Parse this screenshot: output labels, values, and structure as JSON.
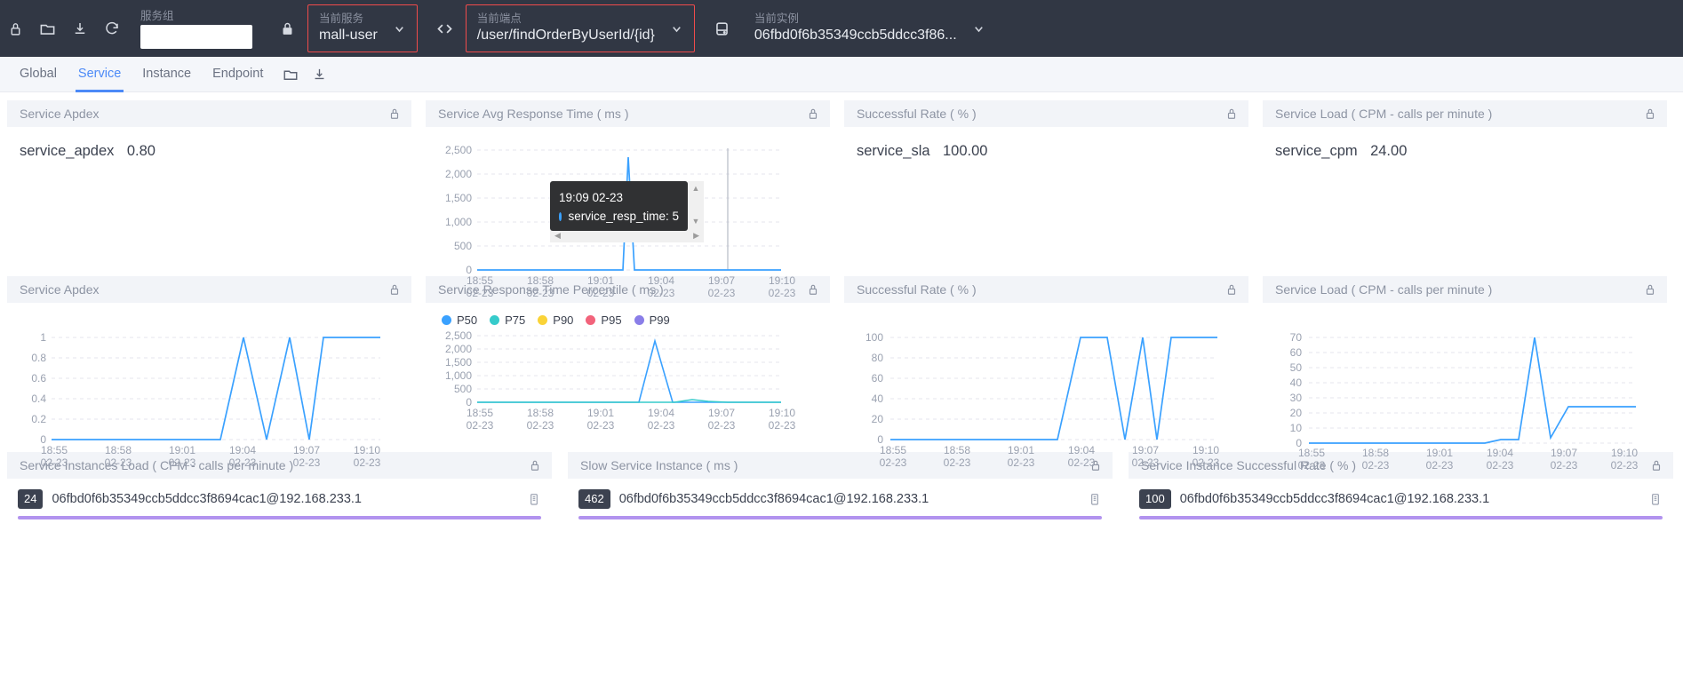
{
  "topbar": {
    "icons": [
      {
        "name": "lock-icon",
        "glyph": "lock"
      },
      {
        "name": "folder-icon",
        "glyph": "folder"
      },
      {
        "name": "download-icon",
        "glyph": "download"
      },
      {
        "name": "refresh-icon",
        "glyph": "refresh"
      }
    ],
    "service_group": {
      "label": "服务组",
      "value": "",
      "placeholder": ""
    },
    "current_service": {
      "label": "当前服务",
      "value": "mall-user",
      "highlight": "#f04b4b"
    },
    "current_endpoint": {
      "label": "当前端点",
      "value": "/user/findOrderByUserId/{id}",
      "highlight": "#f04b4b"
    },
    "current_instance": {
      "label": "当前实例",
      "value": "06fbd0f6b35349ccb5ddcc3f86..."
    }
  },
  "nav": {
    "tabs": [
      {
        "label": "Global",
        "active": false
      },
      {
        "label": "Service",
        "active": true
      },
      {
        "label": "Instance",
        "active": false
      },
      {
        "label": "Endpoint",
        "active": false
      }
    ],
    "icons": [
      {
        "name": "folder-icon"
      },
      {
        "name": "download-icon"
      }
    ]
  },
  "row1": [
    {
      "title": "Service Apdex",
      "type": "metric",
      "metric_label": "service_apdex",
      "metric_value": "0.80"
    },
    {
      "title": "Service Avg Response Time ( ms )",
      "type": "chart",
      "tooltip": {
        "time": "19:09 02-23",
        "series_label": "service_resp_time: 5"
      }
    },
    {
      "title": "Successful Rate ( % )",
      "type": "metric",
      "metric_label": "service_sla",
      "metric_value": "100.00"
    },
    {
      "title": "Service Load ( CPM - calls per minute )",
      "type": "metric",
      "metric_label": "service_cpm",
      "metric_value": "24.00"
    }
  ],
  "row2": [
    {
      "title": "Service Apdex"
    },
    {
      "title": "Service Response Time Percentile ( ms )"
    },
    {
      "title": "Successful Rate ( % )"
    },
    {
      "title": "Service Load ( CPM - calls per minute )"
    }
  ],
  "row3": [
    {
      "title": "Service Instances Load ( CPM - calls per minute )",
      "badge": "24",
      "instance": "06fbd0f6b35349ccb5ddcc3f8694cac1@192.168.233.1"
    },
    {
      "title": "Slow Service Instance ( ms )",
      "badge": "462",
      "instance": "06fbd0f6b35349ccb5ddcc3f8694cac1@192.168.233.1"
    },
    {
      "title": "Service Instance Successful Rate ( % )",
      "badge": "100",
      "instance": "06fbd0f6b35349ccb5ddcc3f8694cac1@192.168.233.1"
    }
  ],
  "legend": {
    "items": [
      {
        "label": "P50",
        "color": "#3aa1ff"
      },
      {
        "label": "P75",
        "color": "#36cbcb"
      },
      {
        "label": "P90",
        "color": "#fad337"
      },
      {
        "label": "P95",
        "color": "#f2637b"
      },
      {
        "label": "P99",
        "color": "#8a7ee8"
      }
    ]
  },
  "chart_data": [
    {
      "id": "avg_resp_time",
      "type": "line",
      "title": "Service Avg Response Time ( ms )",
      "xlabel": "",
      "ylabel": "",
      "ylim": [
        0,
        2500
      ],
      "yticks": [
        0,
        500,
        1000,
        1500,
        2000,
        2500
      ],
      "ytick_labels": [
        "0",
        "500",
        "1,000",
        "1,500",
        "2,000",
        "2,500"
      ],
      "xticks": [
        "18:55\n02-23",
        "18:58\n02-23",
        "19:01\n02-23",
        "19:04\n02-23",
        "19:07\n02-23",
        "19:10\n02-23"
      ],
      "xtick_labels": [
        [
          "18:55",
          "02-23"
        ],
        [
          "18:58",
          "02-23"
        ],
        [
          "19:01",
          "02-23"
        ],
        [
          "19:04",
          "02-23"
        ],
        [
          "19:07",
          "02-23"
        ],
        [
          "19:10",
          "02-23"
        ]
      ],
      "grid": true,
      "series": [
        {
          "name": "service_resp_time",
          "color": "#3aa1ff",
          "values": [
            0,
            0,
            0,
            0,
            0,
            0,
            0,
            0,
            0,
            0,
            0,
            0,
            0,
            0,
            0,
            0,
            0,
            2250,
            0,
            0,
            0,
            0,
            0,
            0,
            5,
            0,
            0,
            0,
            0,
            0,
            0
          ]
        }
      ]
    },
    {
      "id": "service_apdex_line",
      "type": "line",
      "title": "Service Apdex",
      "ylim": [
        0,
        1
      ],
      "yticks": [
        0,
        0.2,
        0.4,
        0.6,
        0.8,
        1
      ],
      "ytick_labels": [
        "0",
        "0.2",
        "0.4",
        "0.6",
        "0.8",
        "1"
      ],
      "xtick_labels": [
        [
          "18:55",
          "02-23"
        ],
        [
          "18:58",
          "02-23"
        ],
        [
          "19:01",
          "02-23"
        ],
        [
          "19:04",
          "02-23"
        ],
        [
          "19:07",
          "02-23"
        ],
        [
          "19:10",
          "02-23"
        ]
      ],
      "grid": true,
      "series": [
        {
          "name": "service_apdex",
          "color": "#3aa1ff",
          "values": [
            0,
            0,
            0,
            0,
            0,
            0,
            0,
            0,
            0,
            0,
            0,
            0,
            0,
            0,
            0,
            0,
            0,
            0,
            0,
            0,
            1,
            0,
            1,
            0,
            0,
            1,
            1
          ]
        }
      ]
    },
    {
      "id": "resp_time_percentile",
      "type": "line",
      "title": "Service Response Time Percentile ( ms )",
      "ylim": [
        0,
        2500
      ],
      "yticks": [
        0,
        500,
        1000,
        1500,
        2000,
        2500
      ],
      "ytick_labels": [
        "0",
        "500",
        "1,000",
        "1,500",
        "2,000",
        "2,500"
      ],
      "xtick_labels": [
        [
          "18:55",
          "02-23"
        ],
        [
          "18:58",
          "02-23"
        ],
        [
          "19:01",
          "02-23"
        ],
        [
          "19:04",
          "02-23"
        ],
        [
          "19:07",
          "02-23"
        ],
        [
          "19:10",
          "02-23"
        ]
      ],
      "grid": true,
      "legend_position": "top-left",
      "series": [
        {
          "name": "P50",
          "color": "#3aa1ff",
          "values": [
            0,
            0,
            0,
            0,
            0,
            0,
            0,
            0,
            0,
            0,
            0,
            0,
            0,
            0,
            0,
            0,
            0,
            2150,
            0,
            0,
            0,
            0,
            0,
            0,
            0,
            0,
            0
          ]
        },
        {
          "name": "P75",
          "color": "#36cbcb",
          "values": [
            0,
            0,
            0,
            0,
            0,
            0,
            0,
            0,
            0,
            0,
            0,
            0,
            0,
            0,
            0,
            0,
            0,
            0,
            0,
            0,
            60,
            0,
            0,
            0,
            0,
            0,
            0
          ]
        },
        {
          "name": "P90",
          "color": "#fad337",
          "values": [
            0,
            0,
            0,
            0,
            0,
            0,
            0,
            0,
            0,
            0,
            0,
            0,
            0,
            0,
            0,
            0,
            0,
            0,
            0,
            0,
            0,
            0,
            0,
            0,
            0,
            0,
            0
          ]
        },
        {
          "name": "P95",
          "color": "#f2637b",
          "values": [
            0,
            0,
            0,
            0,
            0,
            0,
            0,
            0,
            0,
            0,
            0,
            0,
            0,
            0,
            0,
            0,
            0,
            0,
            0,
            0,
            0,
            0,
            0,
            0,
            0,
            0,
            0
          ]
        },
        {
          "name": "P99",
          "color": "#8a7ee8",
          "values": [
            0,
            0,
            0,
            0,
            0,
            0,
            0,
            0,
            0,
            0,
            0,
            0,
            0,
            0,
            0,
            0,
            0,
            0,
            0,
            0,
            0,
            0,
            0,
            0,
            0,
            0,
            0
          ]
        }
      ]
    },
    {
      "id": "successful_rate",
      "type": "line",
      "title": "Successful Rate ( % )",
      "ylim": [
        0,
        100
      ],
      "yticks": [
        0,
        20,
        40,
        60,
        80,
        100
      ],
      "ytick_labels": [
        "0",
        "20",
        "40",
        "60",
        "80",
        "100"
      ],
      "xtick_labels": [
        [
          "18:55",
          "02-23"
        ],
        [
          "18:58",
          "02-23"
        ],
        [
          "19:01",
          "02-23"
        ],
        [
          "19:04",
          "02-23"
        ],
        [
          "19:07",
          "02-23"
        ],
        [
          "19:10",
          "02-23"
        ]
      ],
      "grid": true,
      "series": [
        {
          "name": "service_sla",
          "color": "#3aa1ff",
          "values": [
            0,
            0,
            0,
            0,
            0,
            0,
            0,
            0,
            0,
            0,
            0,
            0,
            0,
            0,
            0,
            0,
            0,
            0,
            0,
            0,
            100,
            100,
            0,
            100,
            0,
            100,
            100
          ]
        }
      ]
    },
    {
      "id": "service_load_cpm",
      "type": "line",
      "title": "Service Load ( CPM - calls per minute )",
      "ylim": [
        0,
        70
      ],
      "yticks": [
        0,
        10,
        20,
        30,
        40,
        50,
        60,
        70
      ],
      "ytick_labels": [
        "0",
        "10",
        "20",
        "30",
        "40",
        "50",
        "60",
        "70"
      ],
      "xtick_labels": [
        [
          "18:55",
          "02-23"
        ],
        [
          "18:58",
          "02-23"
        ],
        [
          "19:01",
          "02-23"
        ],
        [
          "19:04",
          "02-23"
        ],
        [
          "19:07",
          "02-23"
        ],
        [
          "19:10",
          "02-23"
        ]
      ],
      "grid": true,
      "series": [
        {
          "name": "service_cpm",
          "color": "#3aa1ff",
          "values": [
            0,
            0,
            0,
            0,
            0,
            0,
            0,
            0,
            0,
            0,
            0,
            0,
            0,
            0,
            0,
            0,
            0,
            0,
            0,
            2,
            2,
            70,
            2,
            24,
            24,
            24,
            24
          ]
        }
      ]
    }
  ]
}
